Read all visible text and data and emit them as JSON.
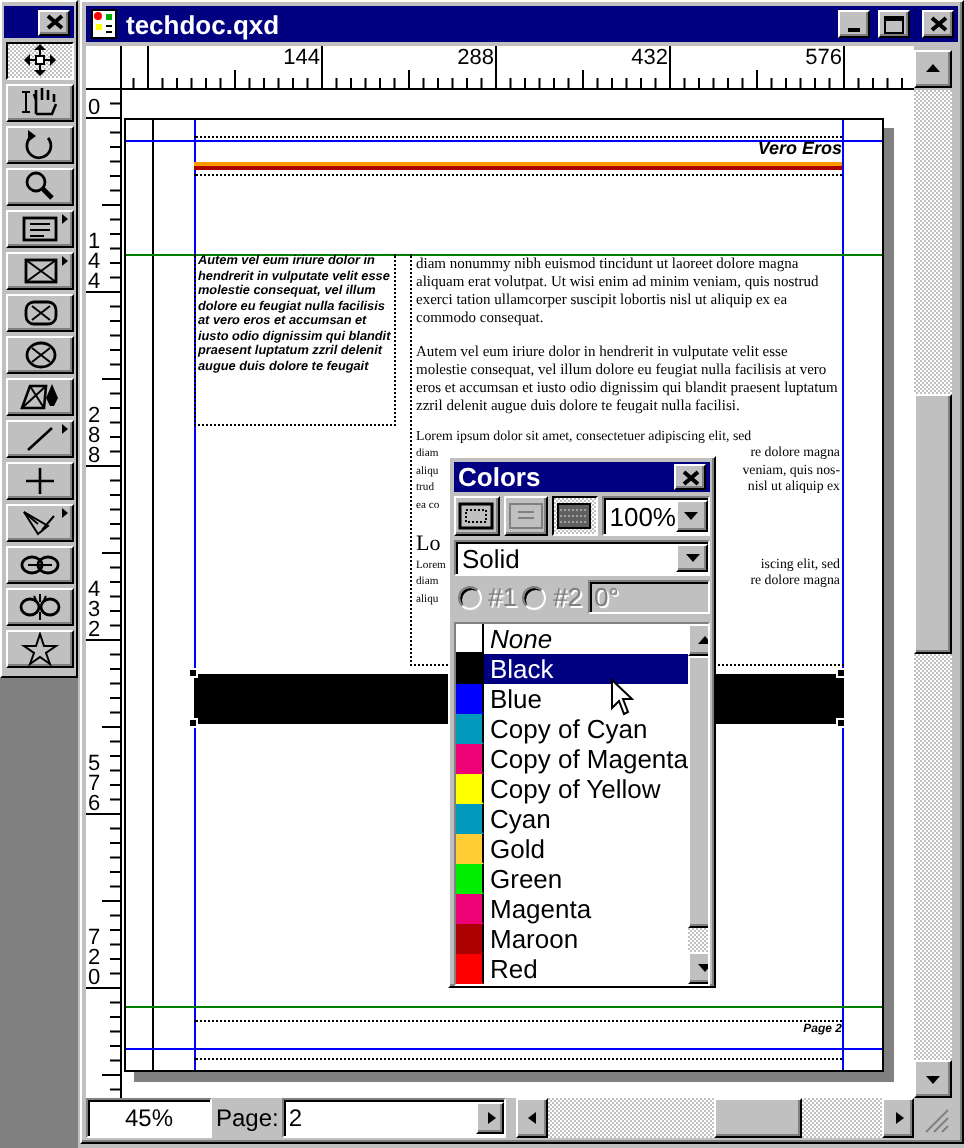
{
  "toolbox": {
    "tools": [
      {
        "kind": "item",
        "selected": true
      },
      {
        "kind": "content",
        "selected": false
      },
      {
        "kind": "rotate",
        "selected": false
      },
      {
        "kind": "zoom",
        "selected": false
      },
      {
        "kind": "text-box",
        "selected": false
      },
      {
        "kind": "rect-picture",
        "selected": false
      },
      {
        "kind": "rounded-picture",
        "selected": false
      },
      {
        "kind": "oval-picture",
        "selected": false
      },
      {
        "kind": "bezier-picture",
        "selected": false
      },
      {
        "kind": "line",
        "selected": false
      },
      {
        "kind": "orthogonal-line",
        "selected": false
      },
      {
        "kind": "pen-line",
        "selected": false
      },
      {
        "kind": "link",
        "selected": false
      },
      {
        "kind": "unlink",
        "selected": false
      },
      {
        "kind": "star",
        "selected": false
      }
    ]
  },
  "window": {
    "title": "techdoc.qxd"
  },
  "rulers": {
    "horizontal": [
      "144",
      "288",
      "432",
      "576"
    ],
    "vertical": [
      "0",
      "144",
      "288",
      "432",
      "576",
      "720"
    ]
  },
  "page": {
    "header": "Vero Eros",
    "sidebar_text": "Autem vel eum iriure dolor in hendrerit in vulputate velit esse molestie consequat, vel illum dolore eu feugiat nulla facilisis at vero eros et accumsan et iusto odio dignissim qui blandit praesent luptatum zzril delenit augue duis dolore te feugait",
    "paragraphs": [
      "diam nonummy nibh euismod tincidunt ut laoreet dolore magna aliquam erat volutpat. Ut wisi enim ad minim veniam, quis nostrud exerci tation ullamcorper suscipit lobortis nisl ut aliquip ex ea commodo consequat.",
      "Autem vel eum iriure dolor in hendrerit in vulputate velit esse molestie consequat, vel illum dolore eu feugiat nulla facilisis at vero eros et accumsan et iusto odio dignissim qui blandit praesent luptatum zzril delenit augue duis dolore te feugait nulla facilisi."
    ],
    "covered_paragraphs": [
      {
        "first_line": "Lorem ipsum dolor sit amet, consectetuer adipiscing elit, sed",
        "lines": [
          [
            "diam",
            "re dolore magna"
          ],
          [
            "aliqu",
            "veniam, quis nos-"
          ],
          [
            "trud",
            "nisl ut aliquip ex"
          ],
          [
            "ea co"
          ]
        ]
      },
      {
        "heading": "Lo",
        "lines": [
          [
            "Lorem",
            "iscing elit, sed"
          ],
          [
            "diam",
            "re dolore magna"
          ],
          [
            "aliqu"
          ]
        ]
      }
    ],
    "footer": "Page 2"
  },
  "colors_palette": {
    "title": "Colors",
    "modes": [
      {
        "kind": "frame",
        "selected": false
      },
      {
        "kind": "text",
        "selected": false
      },
      {
        "kind": "background",
        "selected": true
      }
    ],
    "shade": "100%",
    "blend": "Solid",
    "color_1": "#1",
    "color_2": "#2",
    "angle": "0°",
    "blend_disabled": true,
    "colors": [
      {
        "name": "None",
        "kind": "none",
        "color": "#ffffff",
        "selected": false
      },
      {
        "name": "Black",
        "kind": "color",
        "color": "#000000",
        "selected": true
      },
      {
        "name": "Blue",
        "kind": "color",
        "color": "#0000ff",
        "selected": false
      },
      {
        "name": "Copy of Cyan",
        "kind": "color",
        "color": "#0099bb",
        "selected": false
      },
      {
        "name": "Copy of Magenta",
        "kind": "color",
        "color": "#ee0077",
        "selected": false
      },
      {
        "name": "Copy of Yellow",
        "kind": "color",
        "color": "#ffff00",
        "selected": false
      },
      {
        "name": "Cyan",
        "kind": "color",
        "color": "#0099bb",
        "selected": false
      },
      {
        "name": "Gold",
        "kind": "color",
        "color": "#ffcc33",
        "selected": false
      },
      {
        "name": "Green",
        "kind": "color",
        "color": "#00ee00",
        "selected": false
      },
      {
        "name": "Magenta",
        "kind": "color",
        "color": "#ee0077",
        "selected": false
      },
      {
        "name": "Maroon",
        "kind": "color",
        "color": "#aa0000",
        "selected": false
      },
      {
        "name": "Red",
        "kind": "color",
        "color": "#ff0000",
        "selected": false
      }
    ]
  },
  "status_bar": {
    "zoom": "45%",
    "page_label": "Page:",
    "page": "2"
  }
}
